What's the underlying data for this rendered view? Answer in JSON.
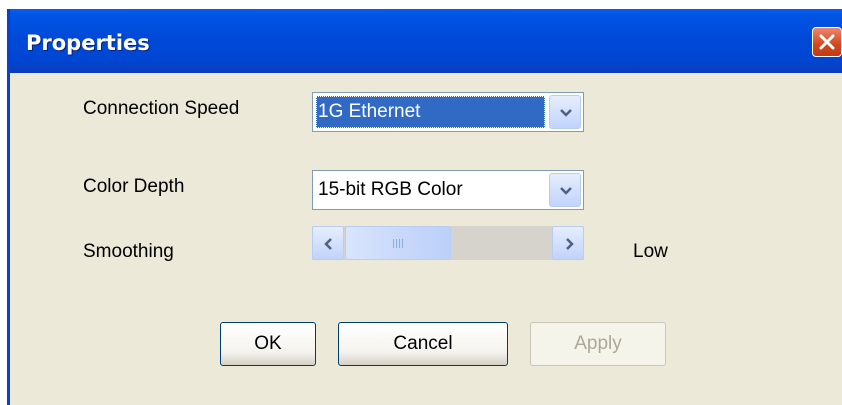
{
  "dialog": {
    "title": "Properties",
    "close_icon": "close-icon"
  },
  "fields": {
    "connection_speed": {
      "label": "Connection Speed",
      "value": "1G Ethernet",
      "focused": true
    },
    "color_depth": {
      "label": "Color Depth",
      "value": "15-bit RGB Color"
    },
    "smoothing": {
      "label": "Smoothing",
      "level_text": "Low",
      "level_fraction": 0.0
    }
  },
  "buttons": {
    "ok": "OK",
    "cancel": "Cancel",
    "apply": "Apply",
    "apply_enabled": false
  },
  "colors": {
    "title_bar": "#0049d8",
    "selection": "#316ac5",
    "dialog_bg": "#ece9d8"
  }
}
